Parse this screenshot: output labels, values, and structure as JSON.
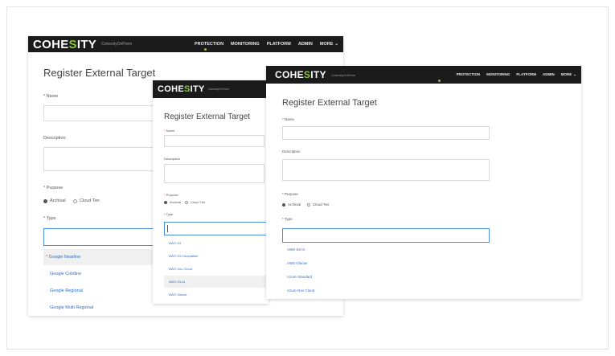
{
  "windows": {
    "back": {
      "logo_pre": "COHE",
      "logo_accent": "S",
      "logo_post": "ITY",
      "cluster": "CohesityOnPrem",
      "nav": [
        "PROTECTION",
        "MONITORING",
        "PLATFORM",
        "ADMIN",
        "MORE"
      ],
      "title": "Register External Target",
      "name_label": "Name",
      "description_label": "Description",
      "purpose_label": "Purpose",
      "purpose_options": [
        "Archival",
        "Cloud Tier"
      ],
      "type_label": "Type",
      "type_options": [
        "Google Nearline",
        "Google Coldline",
        "Google Regional",
        "Google Multi Regional"
      ]
    },
    "middle": {
      "logo_pre": "COHE",
      "logo_accent": "S",
      "logo_post": "ITY",
      "cluster": "CohesityOnPrem",
      "title": "Register External Target",
      "name_label": "Name",
      "description_label": "Description",
      "purpose_label": "Purpose",
      "purpose_options": [
        "Archival",
        "Cloud Tier"
      ],
      "type_label": "Type",
      "type_options": [
        "AWS S3",
        "AWS S3 Compatible",
        "AWS Gov Cloud",
        "AWS S3-IA",
        "AWS Glacier"
      ]
    },
    "front": {
      "logo_pre": "COHE",
      "logo_accent": "S",
      "logo_post": "ITY",
      "cluster": "CohesityOnPrem",
      "nav": [
        "PROTECTION",
        "MONITORING",
        "PLATFORM",
        "ADMIN",
        "MORE"
      ],
      "title": "Register External Target",
      "name_label": "Name",
      "description_label": "Description",
      "purpose_label": "Purpose",
      "purpose_options": [
        "Archival",
        "Cloud Tier"
      ],
      "type_label": "Type",
      "type_options": [
        "AWS S3-IA",
        "AWS Glacier",
        "Azure Standard",
        "Azure Gov Cloud"
      ]
    }
  },
  "colors": {
    "accent": "#8bc53f",
    "topbar": "#1b1b1b",
    "link": "#2e6fc7",
    "focus": "#4a90e2"
  }
}
